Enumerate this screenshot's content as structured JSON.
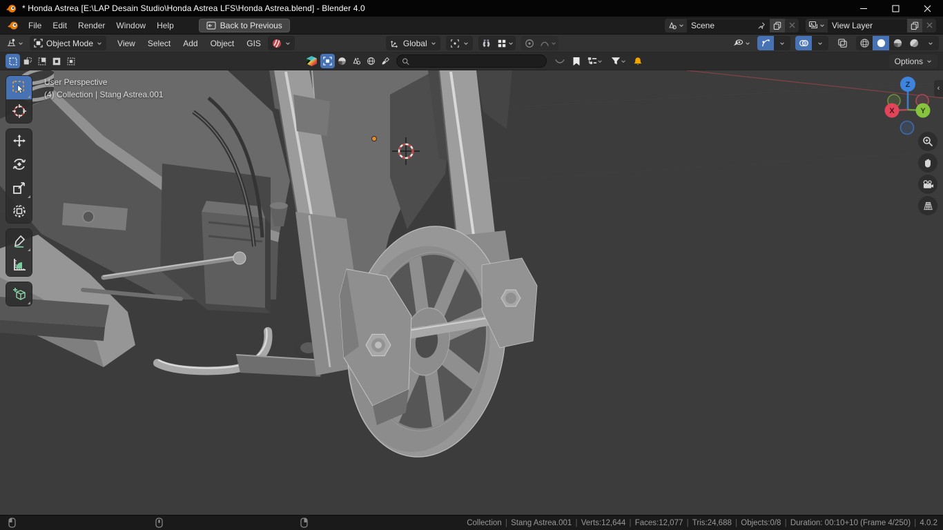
{
  "window": {
    "title": "* Honda Astrea [E:\\LAP Desain Studio\\Honda Astrea LFS\\Honda Astrea.blend] - Blender 4.0"
  },
  "topbar": {
    "menus": {
      "file": "File",
      "edit": "Edit",
      "render": "Render",
      "window": "Window",
      "help": "Help"
    },
    "back_label": "Back to Previous",
    "scene_label": "Scene",
    "view_layer_label": "View Layer"
  },
  "header": {
    "mode_label": "Object Mode",
    "menus": {
      "view": "View",
      "select": "Select",
      "add": "Add",
      "object": "Object",
      "gis": "GIS"
    },
    "orientation_label": "Global"
  },
  "tool_settings": {
    "options_label": "Options",
    "search_value": "",
    "search_placeholder": ""
  },
  "viewport": {
    "overlay_line1": "User Perspective",
    "overlay_line2": "(4) Collection | Stang Astrea.001",
    "gizmo": {
      "x": "X",
      "y": "Y",
      "z": "Z"
    }
  },
  "statusbar": {
    "segments": {
      "collection": "Collection",
      "object": "Stang Astrea.001",
      "verts": "Verts:12,644",
      "faces": "Faces:12,077",
      "tris": "Tris:24,688",
      "objects": "Objects:0/8",
      "duration": "Duration: 00:10+10 (Frame 4/250)",
      "version": "4.0.2"
    }
  },
  "colors": {
    "accent_blue": "#4772b3",
    "axis_x": "#e0455a",
    "axis_y": "#86c33e",
    "axis_z": "#3e83dd",
    "blender_orange": "#ea7600",
    "bell_orange": "#f0a500",
    "annotate_green": "#7acb9e",
    "viewport_bg": "#3c3c3c",
    "origin_dot": "#e78c28"
  }
}
